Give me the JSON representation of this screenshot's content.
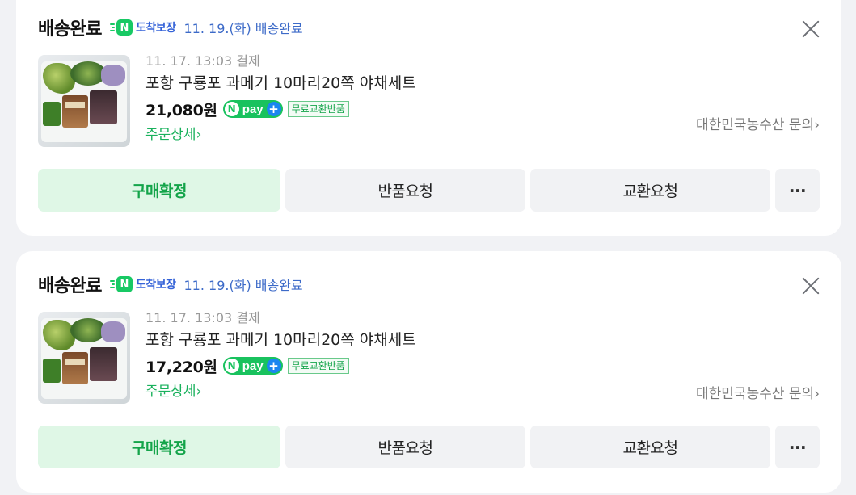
{
  "orders": [
    {
      "status": "배송완료",
      "guarantee_label": "도착보장",
      "delivery_info": "11. 19.(화) 배송완료",
      "payment_time": "11. 17. 13:03 결제",
      "product_name": "포항 구룡포 과메기 10마리20쪽 야채세트",
      "price": "21,080원",
      "free_return_badge": "무료교환반품",
      "detail_link": "주문상세",
      "seller_inquiry": "대한민국농수산 문의",
      "buttons": {
        "confirm": "구매확정",
        "return": "반품요청",
        "exchange": "교환요청",
        "more": "···"
      }
    },
    {
      "status": "배송완료",
      "guarantee_label": "도착보장",
      "delivery_info": "11. 19.(화) 배송완료",
      "payment_time": "11. 17. 13:03 결제",
      "product_name": "포항 구룡포 과메기 10마리20쪽 야채세트",
      "price": "17,220원",
      "free_return_badge": "무료교환반품",
      "detail_link": "주문상세",
      "seller_inquiry": "대한민국농수산 문의",
      "buttons": {
        "confirm": "구매확정",
        "return": "반품요청",
        "exchange": "교환요청",
        "more": "···"
      }
    }
  ],
  "npay": {
    "n": "N",
    "pay": "pay",
    "plus": "+"
  },
  "guarantee_icon_letter": "N",
  "chevron": "›",
  "icons": {
    "guarantee": "n-delivery-guarantee-icon",
    "close": "close-icon",
    "npay": "npay-plus-icon",
    "more": "more-dots-icon",
    "chevron": "chevron-right-icon"
  },
  "colors": {
    "green": "#19b15c",
    "blue": "#3c6ac8",
    "confirm_bg": "#dff7e6"
  }
}
